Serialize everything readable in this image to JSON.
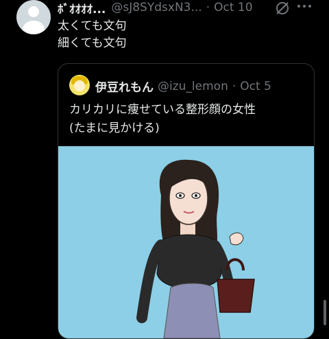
{
  "tweet": {
    "name": "ﾎﾞｵｵｵｵ...",
    "handle": "@sJ8SYdsxN3...",
    "separator": "·",
    "date": "Oct 10",
    "lines": [
      "太くても文句",
      "細くても文句"
    ],
    "icons": [
      "grok-icon",
      "more-icon"
    ]
  },
  "quote": {
    "name": "伊豆れもん",
    "handle": "@izu_lemon",
    "separator": "·",
    "date": "Oct 5",
    "lines": [
      "カリカリに痩せている整形顔の女性",
      "(たまに見かける)"
    ],
    "image_background": "#8ccfe6"
  },
  "colors": {
    "background": "#000000",
    "text": "#e7e9ea",
    "muted": "#71767b",
    "border": "#2f3336"
  }
}
